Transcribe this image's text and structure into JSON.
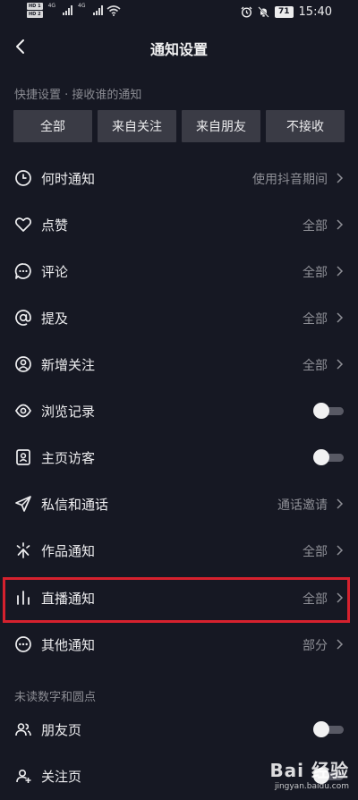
{
  "status_bar": {
    "hd1": "HD 1",
    "hd2": "HD 2",
    "net1": "4G",
    "net2": "4G",
    "battery": "71",
    "time": "15:40"
  },
  "nav": {
    "title": "通知设置"
  },
  "quick": {
    "label": "快捷设置 · 接收谁的通知",
    "options": [
      "全部",
      "来自关注",
      "来自朋友",
      "不接收"
    ]
  },
  "items": [
    {
      "label": "何时通知",
      "value": "使用抖音期间",
      "icon": "clock-icon"
    },
    {
      "label": "点赞",
      "value": "全部",
      "icon": "heart-icon"
    },
    {
      "label": "评论",
      "value": "全部",
      "icon": "comment-icon"
    },
    {
      "label": "提及",
      "value": "全部",
      "icon": "at-icon"
    },
    {
      "label": "新增关注",
      "value": "全部",
      "icon": "user-circle-icon"
    },
    {
      "label": "浏览记录",
      "toggle": false,
      "icon": "eye-icon"
    },
    {
      "label": "主页访客",
      "toggle": false,
      "icon": "profile-card-icon"
    },
    {
      "label": "私信和通话",
      "value": "通话邀请",
      "icon": "send-icon"
    },
    {
      "label": "作品通知",
      "value": "全部",
      "icon": "sparkle-icon"
    },
    {
      "label": "直播通知",
      "value": "全部",
      "icon": "bars-icon"
    },
    {
      "label": "其他通知",
      "value": "部分",
      "icon": "more-icon"
    }
  ],
  "unread_section": {
    "label": "未读数字和圆点",
    "items": [
      {
        "label": "朋友页",
        "toggle": false,
        "icon": "friends-icon"
      },
      {
        "label": "关注页",
        "toggle": false,
        "icon": "follow-icon"
      }
    ]
  },
  "watermark": {
    "top": "Bai 经验",
    "bottom": "jingyan.baidu.com"
  },
  "colors": {
    "background": "#161823",
    "button": "#3a3b45",
    "highlight": "#d5212e"
  }
}
